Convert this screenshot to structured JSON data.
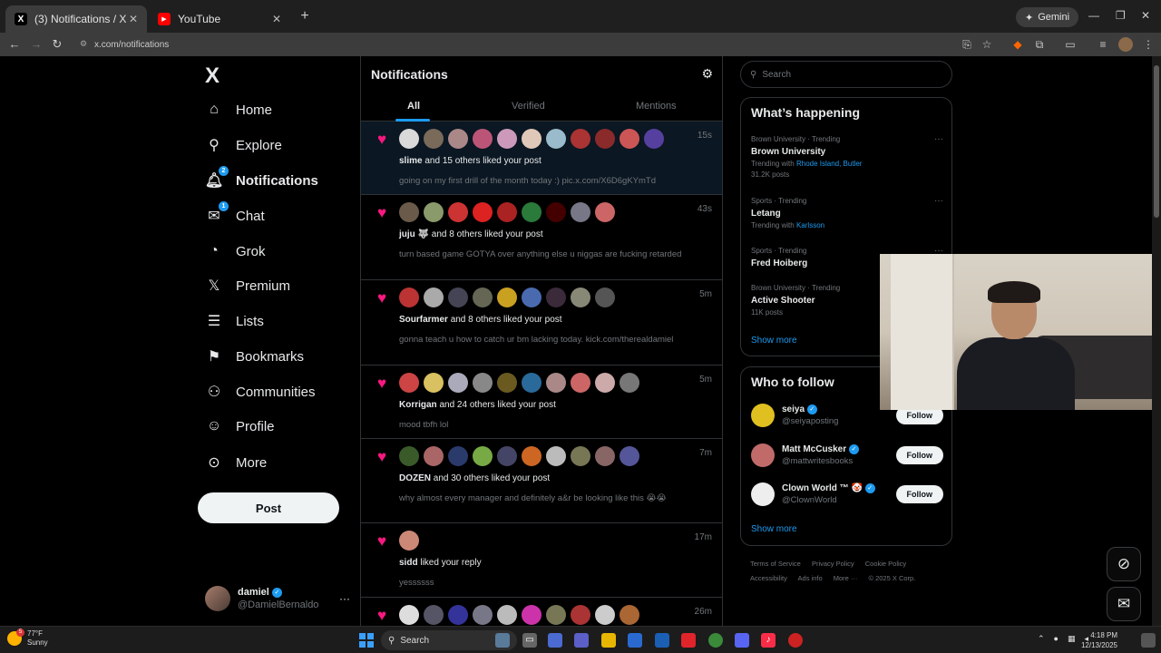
{
  "browser": {
    "tabs": [
      {
        "title": "(3) Notifications / X",
        "favicon": "X"
      },
      {
        "title": "YouTube",
        "favicon": "▶"
      }
    ],
    "gemini_label": "Gemini",
    "url": "x.com/notifications"
  },
  "nav": {
    "logo": "X",
    "items": [
      {
        "label": "Home",
        "icon": "home-icon"
      },
      {
        "label": "Explore",
        "icon": "search-icon"
      },
      {
        "label": "Notifications",
        "icon": "bell-icon",
        "badge": "2"
      },
      {
        "label": "Chat",
        "icon": "mail-icon",
        "badge": "1"
      },
      {
        "label": "Grok",
        "icon": "grok-icon"
      },
      {
        "label": "Premium",
        "icon": "x-icon"
      },
      {
        "label": "Lists",
        "icon": "list-icon"
      },
      {
        "label": "Bookmarks",
        "icon": "bookmark-icon"
      },
      {
        "label": "Communities",
        "icon": "communities-icon"
      },
      {
        "label": "Profile",
        "icon": "person-icon"
      },
      {
        "label": "More",
        "icon": "more-circle-icon"
      }
    ],
    "post_label": "Post",
    "account": {
      "name": "damiel",
      "handle": "@DamielBernaldo"
    }
  },
  "feed": {
    "title": "Notifications",
    "tabs": [
      "All",
      "Verified",
      "Mentions"
    ],
    "notifications": [
      {
        "user": "slime",
        "rest": "and 15 others liked your post",
        "snippet": "going on my first drill of the month today :) pic.x.com/X6D6gKYmTd",
        "time": "15s",
        "highlight": true,
        "avatars": [
          "#d9d9d9",
          "#7a6a5a",
          "#a88",
          "#b57",
          "#c9b",
          "#e0c8b8",
          "#9bc",
          "#a33",
          "#8a2a2a",
          "#c55",
          "#5540a0"
        ]
      },
      {
        "user": "juju 🐺",
        "rest": "and 8 others liked your post",
        "snippet": "turn based game GOTYA over anything else u niggas are fucking retarded",
        "time": "43s",
        "highlight": false,
        "avatars": [
          "#6a5a4a",
          "#8a9a6a",
          "#c33",
          "#d22",
          "#a22",
          "#2a7a3a",
          "#400",
          "#778",
          "#c66"
        ]
      },
      {
        "user": "Sourfarmer",
        "rest": "and 8 others liked your post",
        "snippet": "gonna teach u how to catch ur bm lacking today. kick.com/therealdamiel",
        "time": "5m",
        "highlight": false,
        "avatars": [
          "#b33",
          "#aaa",
          "#445",
          "#665",
          "#c9a020",
          "#4a6ab0",
          "#3a2a3a",
          "#887",
          "#555"
        ]
      },
      {
        "user": "Korrigan",
        "rest": "and 24 others liked your post",
        "snippet": "mood tbfh lol",
        "time": "5m",
        "highlight": false,
        "avatars": [
          "#c44",
          "#d9c060",
          "#aab",
          "#888",
          "#6a5a20",
          "#2a6a9a",
          "#a88",
          "#c66",
          "#caa",
          "#777"
        ]
      },
      {
        "user": "DOZEN",
        "rest": "and 30 others liked your post",
        "snippet": "why almost every manager and definitely a&r be looking like this 😭😭",
        "time": "7m",
        "highlight": false,
        "avatars": [
          "#3a5a2a",
          "#a66",
          "#2a3a6a",
          "#7a4",
          "#446",
          "#c62",
          "#bbb",
          "#775",
          "#866",
          "#559"
        ]
      },
      {
        "user": "sidd",
        "rest": "liked your reply",
        "snippet": "yessssss",
        "time": "17m",
        "highlight": false,
        "avatars": [
          "#c87"
        ]
      },
      {
        "user": "",
        "rest": "",
        "snippet": "",
        "time": "26m",
        "highlight": false,
        "avatars": [
          "#ddd",
          "#556",
          "#339",
          "#778",
          "#bbb",
          "#c3a",
          "#775",
          "#a33",
          "#ccc",
          "#a63"
        ]
      }
    ]
  },
  "right": {
    "search_placeholder": "Search",
    "happening_title": "What’s happening",
    "trends": [
      {
        "meta": "Brown University · Trending",
        "name": "Brown University",
        "trending_with_label": "Trending with",
        "trending_with": "Rhode Island, Butler",
        "posts": "31.2K posts"
      },
      {
        "meta": "Sports · Trending",
        "name": "Letang",
        "trending_with_label": "Trending with",
        "trending_with": "Karlsson",
        "posts": ""
      },
      {
        "meta": "Sports · Trending",
        "name": "Fred Hoiberg",
        "trending_with_label": "",
        "trending_with": "",
        "posts": ""
      },
      {
        "meta": "Brown University · Trending",
        "name": "Active Shooter",
        "trending_with_label": "",
        "trending_with": "",
        "posts": "11K posts"
      }
    ],
    "show_more": "Show more",
    "wtf_title": "Who to follow",
    "who_to_follow": [
      {
        "name": "seiya",
        "handle": "@seiyaposting",
        "color": "#e0c020"
      },
      {
        "name": "Matt McCusker",
        "handle": "@mattwritesbooks",
        "color": "#c06a6a"
      },
      {
        "name": "Clown World ™ 🤡",
        "handle": "@ClownWorld",
        "color": "#eee"
      }
    ],
    "follow_label": "Follow",
    "footer": [
      "Terms of Service",
      "Privacy Policy",
      "Cookie Policy",
      "Accessibility",
      "Ads info",
      "More ···",
      "© 2025 X Corp."
    ]
  },
  "taskbar": {
    "weather_temp": "77°F",
    "weather_desc": "Sunny",
    "weather_badge": "5",
    "search_label": "Search",
    "time": "4:18 PM",
    "date": "12/13/2025"
  }
}
